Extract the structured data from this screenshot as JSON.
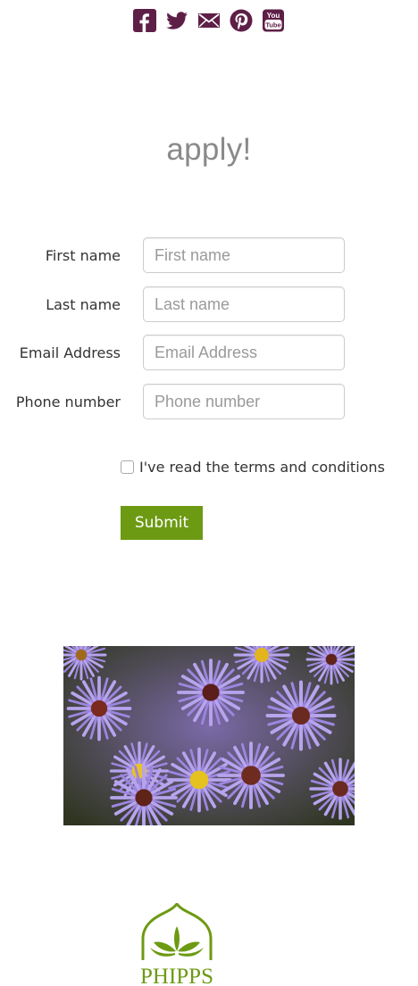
{
  "social": {
    "color": "#5e1f47",
    "icons": [
      "facebook-icon",
      "twitter-icon",
      "email-icon",
      "pinterest-icon",
      "youtube-icon"
    ]
  },
  "heading": "apply!",
  "form": {
    "fields": [
      {
        "label": "First name",
        "placeholder": "First name",
        "value": ""
      },
      {
        "label": "Last name",
        "placeholder": "Last name",
        "value": ""
      },
      {
        "label": "Email Address",
        "placeholder": "Email Address",
        "value": ""
      },
      {
        "label": "Phone number",
        "placeholder": "Phone number",
        "value": ""
      }
    ],
    "terms_label": "I've read the terms and conditions",
    "terms_checked": false,
    "submit_label": "Submit",
    "submit_color": "#6d9a13"
  },
  "logo": {
    "text": "PHIPPS",
    "color": "#6d9a13"
  }
}
